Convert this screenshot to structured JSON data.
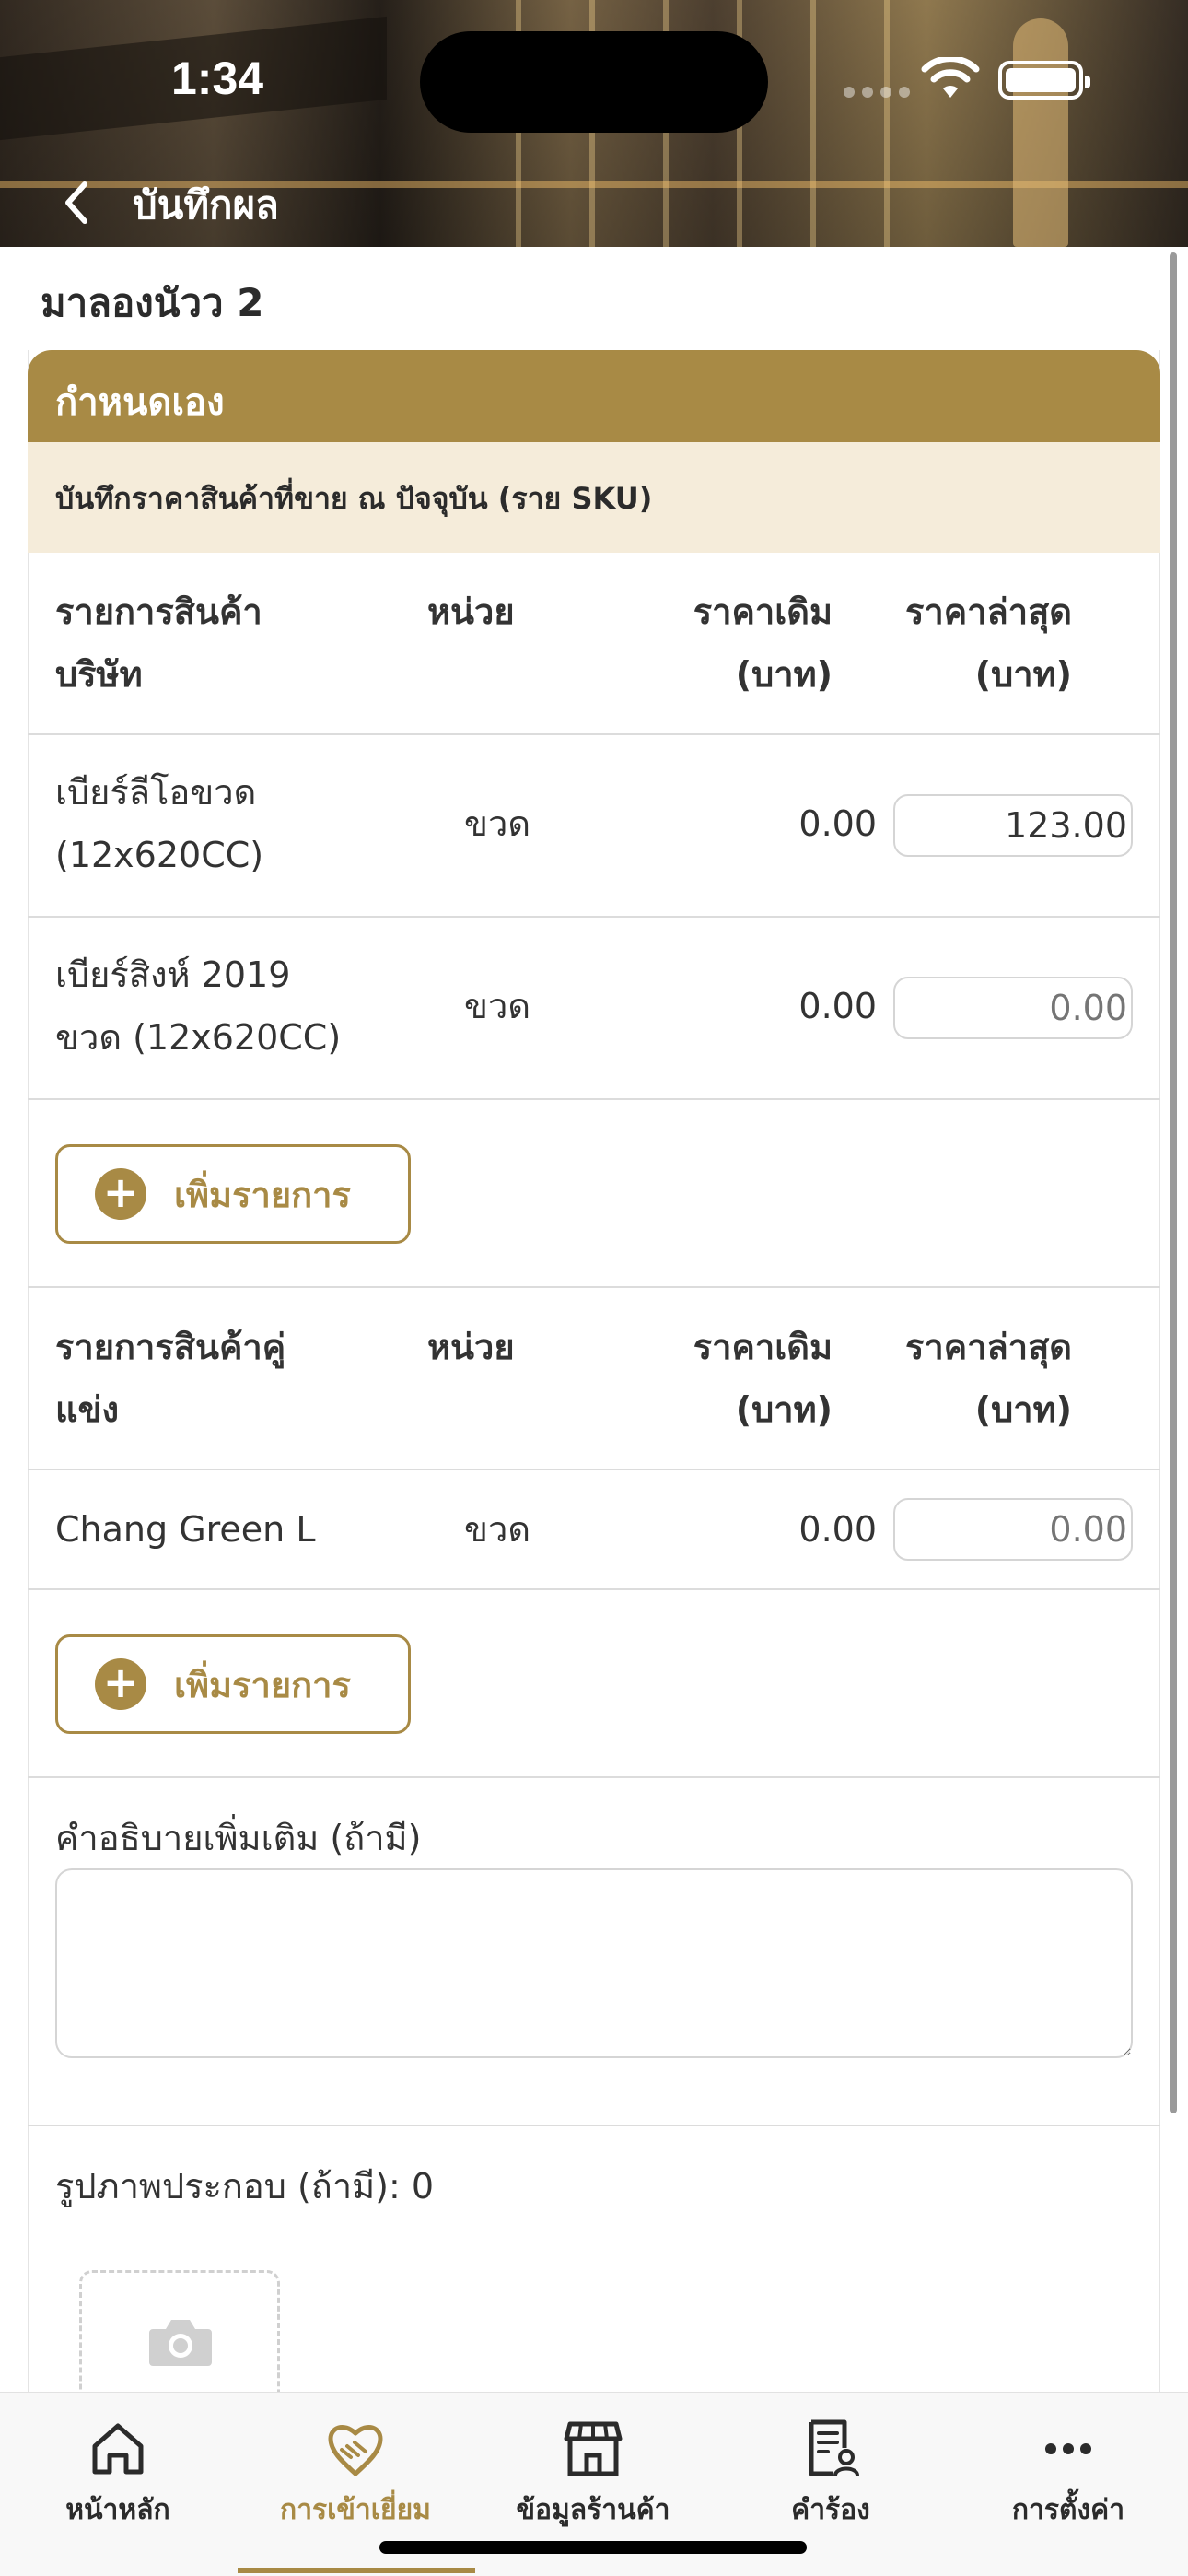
{
  "status_bar": {
    "time": "1:34"
  },
  "nav": {
    "title": "บันทึกผล"
  },
  "store": {
    "name": "มาลองนัวว 2"
  },
  "section": {
    "title": "กำหนดเอง",
    "subtitle": "บันทึกราคาสินค้าที่ขาย ณ ปัจจุบัน (ราย SKU)"
  },
  "company_table": {
    "headers": {
      "item_line1": "รายการสินค้า",
      "item_line2": "บริษัท",
      "unit": "หน่วย",
      "old_price_line1": "ราคาเดิม",
      "old_price_line2": "(บาท)",
      "new_price_line1": "ราคาล่าสุด",
      "new_price_line2": "(บาท)"
    },
    "rows": [
      {
        "name_line1": "เบียร์ลีโอขวด",
        "name_line2": "(12x620CC)",
        "unit": "ขวด",
        "old_price": "0.00",
        "new_price_value": "123.00",
        "new_price_placeholder": ""
      },
      {
        "name_line1": "เบียร์สิงห์ 2019",
        "name_line2": "ขวด (12x620CC)",
        "unit": "ขวด",
        "old_price": "0.00",
        "new_price_value": "",
        "new_price_placeholder": "0.00"
      }
    ],
    "add_label": "เพิ่มรายการ"
  },
  "competitor_table": {
    "headers": {
      "item_line1": "รายการสินค้าคู่",
      "item_line2": "แข่ง",
      "unit": "หน่วย",
      "old_price_line1": "ราคาเดิม",
      "old_price_line2": "(บาท)",
      "new_price_line1": "ราคาล่าสุด",
      "new_price_line2": "(บาท)"
    },
    "rows": [
      {
        "name": "Chang Green L",
        "unit": "ขวด",
        "old_price": "0.00",
        "new_price_placeholder": "0.00"
      }
    ],
    "add_label": "เพิ่มรายการ"
  },
  "note": {
    "label": "คำอธิบายเพิ่มเติม (ถ้ามี)",
    "value": ""
  },
  "photos": {
    "label": "รูปภาพประกอบ (ถ้ามี): 0"
  },
  "tabbar": {
    "items": [
      {
        "label": "หน้าหลัก",
        "icon": "home-icon"
      },
      {
        "label": "การเข้าเยี่ยม",
        "icon": "handshake-icon"
      },
      {
        "label": "ข้อมูลร้านค้า",
        "icon": "store-icon"
      },
      {
        "label": "คำร้อง",
        "icon": "request-icon"
      },
      {
        "label": "การตั้งค่า",
        "icon": "more-icon"
      }
    ],
    "active_index": 1
  },
  "colors": {
    "accent": "#a88a45",
    "subtitle_bg": "#f5ecda"
  }
}
